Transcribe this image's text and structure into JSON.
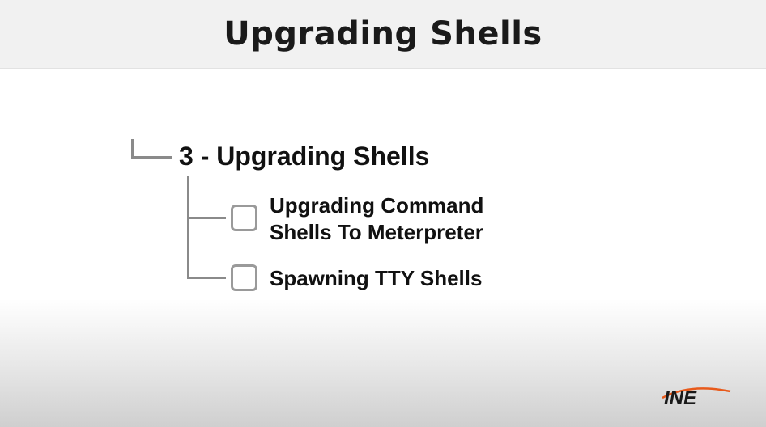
{
  "header": {
    "title": "Upgrading Shells"
  },
  "outline": {
    "section": "3 - Upgrading Shells",
    "items": [
      {
        "label": "Upgrading Command\nShells To Meterpreter",
        "checked": false
      },
      {
        "label": "Spawning TTY Shells",
        "checked": false
      }
    ]
  },
  "branding": {
    "logo_text": "INE",
    "logo_color": "#1a1a1a",
    "logo_accent": "#e85a1b"
  }
}
